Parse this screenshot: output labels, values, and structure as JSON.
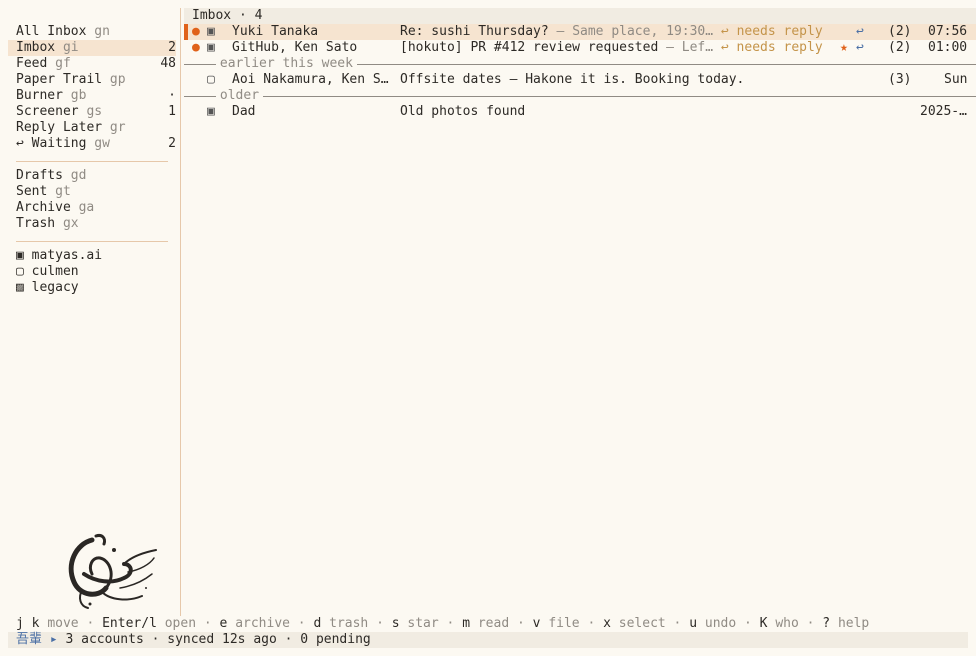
{
  "sidebar": {
    "mailboxes": [
      {
        "label": "All Inbox",
        "key": "gn",
        "count": ""
      },
      {
        "label": "Imbox",
        "key": "gi",
        "count": "2"
      },
      {
        "label": "Feed",
        "key": "gf",
        "count": "48"
      },
      {
        "label": "Paper Trail",
        "key": "gp",
        "count": ""
      },
      {
        "label": "Burner",
        "key": "gb",
        "count": "·"
      },
      {
        "label": "Screener",
        "key": "gs",
        "count": "1"
      },
      {
        "label": "Reply Later",
        "key": "gr",
        "count": ""
      },
      {
        "label": "↩ Waiting",
        "key": "gw",
        "count": "2"
      }
    ],
    "folders": [
      {
        "label": "Drafts",
        "key": "gd"
      },
      {
        "label": "Sent",
        "key": "gt"
      },
      {
        "label": "Archive",
        "key": "ga"
      },
      {
        "label": "Trash",
        "key": "gx"
      }
    ],
    "accounts": [
      {
        "icon": "▣",
        "label": "matyas.ai"
      },
      {
        "icon": "▢",
        "label": "culmen"
      },
      {
        "icon": "▨",
        "label": "legacy"
      }
    ]
  },
  "list": {
    "header": "Imbox · 4",
    "sections": [
      {
        "label": "",
        "rows": [
          {
            "dot": "●",
            "acct": "▣",
            "from": "Yuki Tanaka",
            "subject": "Re: sushi Thursday?",
            "snippet": " — Same place, 19:30…",
            "tag": " ↩ needs reply",
            "star": "",
            "reply": "↩",
            "count": "(2)",
            "time": "07:56"
          },
          {
            "dot": "●",
            "acct": "▣",
            "from": "GitHub, Ken Sato",
            "subject": "[hokuto] PR #412 review requested",
            "snippet": " — Lef…",
            "tag": " ↩ needs reply",
            "star": "★",
            "reply": "↩",
            "count": "(2)",
            "time": "01:00"
          }
        ]
      },
      {
        "label": "earlier this week",
        "rows": [
          {
            "dot": "",
            "acct": "▢",
            "from": "Aoi Nakamura, Ken S…",
            "subject": "Offsite dates — Hakone it is. Booking today.",
            "snippet": "",
            "tag": "",
            "star": "",
            "reply": "",
            "count": "(3)",
            "time": "Sun"
          }
        ]
      },
      {
        "label": "older",
        "rows": [
          {
            "dot": "",
            "acct": "▣",
            "from": "Dad",
            "subject": "Old photos found",
            "snippet": "",
            "tag": "",
            "star": "",
            "reply": "",
            "count": "",
            "time": "2025-…"
          }
        ]
      }
    ]
  },
  "help": [
    {
      "k": "j k",
      "d": "move"
    },
    {
      "k": "Enter/l",
      "d": "open"
    },
    {
      "k": "e",
      "d": "archive"
    },
    {
      "k": "d",
      "d": "trash"
    },
    {
      "k": "s",
      "d": "star"
    },
    {
      "k": "m",
      "d": "read"
    },
    {
      "k": "v",
      "d": "file"
    },
    {
      "k": "x",
      "d": "select"
    },
    {
      "k": "u",
      "d": "undo"
    },
    {
      "k": "K",
      "d": "who"
    },
    {
      "k": "?",
      "d": "help"
    }
  ],
  "status": {
    "brand": "吾輩",
    "arrow": "▸",
    "text": "3 accounts · synced 12s ago · 0 pending"
  },
  "colors": {
    "accent": "#e0621a",
    "selection": "#f6e4d0",
    "link": "#4a6fa5",
    "tag": "#c4944a"
  }
}
